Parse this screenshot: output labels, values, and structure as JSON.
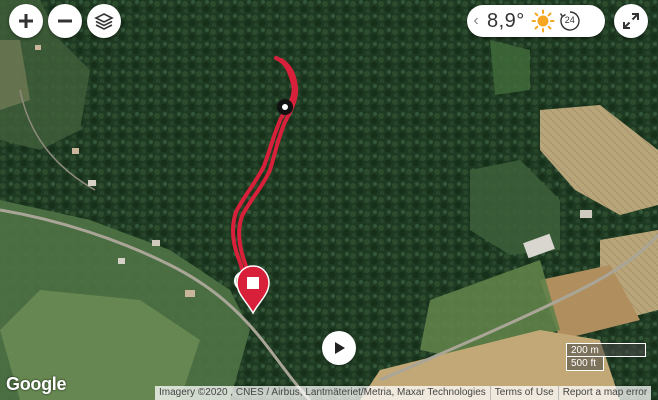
{
  "map": {
    "imagery_type": "satellite",
    "track_color": "#d9203a"
  },
  "controls": {
    "zoom_in_icon": "plus-icon",
    "zoom_out_icon": "minus-icon",
    "layers_icon": "layers-icon",
    "fullscreen_icon": "expand-icon",
    "play_icon": "play-icon"
  },
  "weather": {
    "temperature": "8,9°",
    "condition_icon": "sun-icon",
    "hours": "24",
    "prev_icon": "chevron-left-icon"
  },
  "scale": {
    "metric": "200 m",
    "imperial": "500 ft"
  },
  "footer": {
    "logo": "Google",
    "imagery": "Imagery ©2020 , CNES / Airbus, Lantmäteriet/Metria, Maxar Technologies",
    "terms": "Terms of Use",
    "report": "Report a map error"
  },
  "colors": {
    "track": "#d9203a",
    "end_marker": "#d9203a",
    "start_marker": "#3aa935",
    "waypoint": "#111111"
  }
}
